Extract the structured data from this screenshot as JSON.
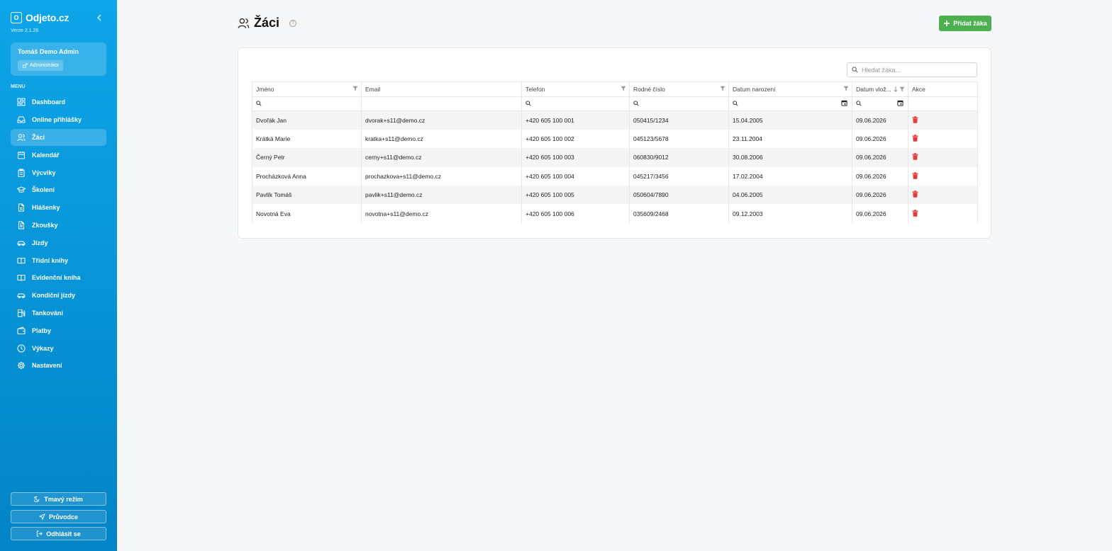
{
  "sidebar": {
    "brand_logo": "O",
    "brand_name": "Odjeto.cz",
    "version": "Verze 2.1.26",
    "user": {
      "name": "Tomáš Demo Admin",
      "role": "Administrátor"
    },
    "menu_heading": "MENU",
    "items": [
      {
        "label": "Dashboard",
        "icon": "dashboard-icon"
      },
      {
        "label": "Online přihlášky",
        "icon": "inbox-icon"
      },
      {
        "label": "Žáci",
        "icon": "users-icon",
        "active": true
      },
      {
        "label": "Kalendář",
        "icon": "calendar-icon"
      },
      {
        "label": "Výcviky",
        "icon": "clipboard-icon"
      },
      {
        "label": "Školení",
        "icon": "graduation-cap-icon"
      },
      {
        "label": "Hlášenky",
        "icon": "file-icon"
      },
      {
        "label": "Zkoušky",
        "icon": "file-text-icon"
      },
      {
        "label": "Jízdy",
        "icon": "car-icon"
      },
      {
        "label": "Třídní knihy",
        "icon": "book-open-icon"
      },
      {
        "label": "Evidenční kniha",
        "icon": "book-icon"
      },
      {
        "label": "Kondiční jízdy",
        "icon": "car-icon"
      },
      {
        "label": "Tankování",
        "icon": "fuel-icon"
      },
      {
        "label": "Platby",
        "icon": "wallet-icon"
      },
      {
        "label": "Výkazy",
        "icon": "clock-icon"
      },
      {
        "label": "Nastavení",
        "icon": "gear-icon"
      }
    ],
    "dark_mode_label": "Tmavý režim",
    "guide_label": "Průvodce",
    "logout_label": "Odhlásit se"
  },
  "header": {
    "title": "Žáci",
    "add_button_label": "Přidat žáka"
  },
  "search": {
    "placeholder": "Hledat žáka..."
  },
  "table": {
    "columns": [
      "Jméno",
      "Email",
      "Telefon",
      "Rodné číslo",
      "Datum narození",
      "Datum vlož...",
      "Akce"
    ],
    "rows": [
      {
        "name": "Dvořák Jan",
        "email": "dvorak+s11@demo.cz",
        "phone": "+420 605 100 001",
        "rc": "050415/1234",
        "birth": "15.04.2005",
        "inserted": "09.06.2026"
      },
      {
        "name": "Krátká Marie",
        "email": "kratka+s11@demo.cz",
        "phone": "+420 605 100 002",
        "rc": "045123/5678",
        "birth": "23.11.2004",
        "inserted": "09.06.2026"
      },
      {
        "name": "Černý Petr",
        "email": "cerny+s11@demo.cz",
        "phone": "+420 605 100 003",
        "rc": "060830/9012",
        "birth": "30.08.2006",
        "inserted": "09.06.2026"
      },
      {
        "name": "Procházková Anna",
        "email": "prochazkova+s11@demo.cz",
        "phone": "+420 605 100 004",
        "rc": "045217/3456",
        "birth": "17.02.2004",
        "inserted": "09.06.2026"
      },
      {
        "name": "Pavlík Tomáš",
        "email": "pavlik+s11@demo.cz",
        "phone": "+420 605 100 005",
        "rc": "050604/7890",
        "birth": "04.06.2005",
        "inserted": "09.06.2026"
      },
      {
        "name": "Novotná Eva",
        "email": "novotna+s11@demo.cz",
        "phone": "+420 605 100 006",
        "rc": "035609/2468",
        "birth": "09.12.2003",
        "inserted": "09.06.2026"
      }
    ]
  },
  "colors": {
    "sidebar": "#0ea5e9",
    "add_button": "#4caf50",
    "delete": "#e53935"
  }
}
